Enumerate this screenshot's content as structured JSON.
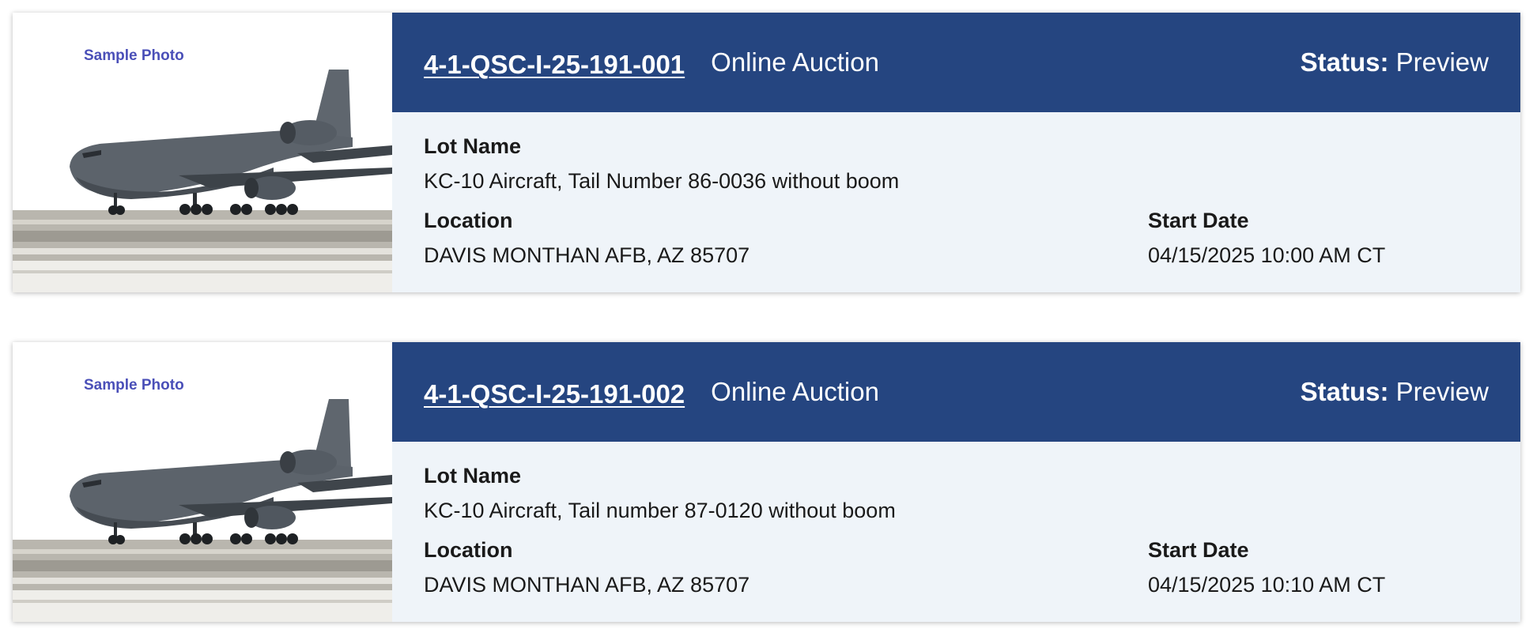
{
  "labels": {
    "lot_name": "Lot Name",
    "location": "Location",
    "start_date": "Start Date",
    "status": "Status:"
  },
  "colors": {
    "header_bg": "#254580",
    "card_body_bg": "#eff4f9",
    "photo_caption": "#4a4fb8"
  },
  "lots": [
    {
      "photo_caption": "Sample Photo",
      "lot_number": "4-1-QSC-I-25-191-001",
      "auction_type": "Online Auction",
      "status": "Preview",
      "lot_name": "KC-10 Aircraft, Tail Number 86-0036 without boom",
      "location": "DAVIS MONTHAN AFB, AZ 85707",
      "start_date": "04/15/2025 10:00 AM CT"
    },
    {
      "photo_caption": "Sample Photo",
      "lot_number": "4-1-QSC-I-25-191-002",
      "auction_type": "Online Auction",
      "status": "Preview",
      "lot_name": "KC-10 Aircraft, Tail number 87-0120 without boom",
      "location": "DAVIS MONTHAN AFB, AZ 85707",
      "start_date": "04/15/2025 10:10 AM CT"
    }
  ]
}
